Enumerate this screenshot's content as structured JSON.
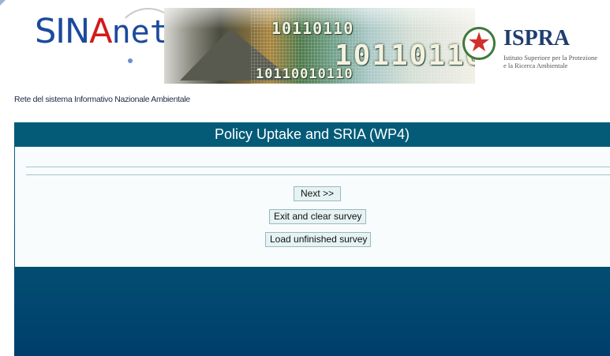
{
  "header": {
    "logo": {
      "part1": "SIN",
      "part2": "A",
      "part3": "net"
    },
    "banner_bits": [
      "10110110",
      "10110110",
      "10110010110"
    ],
    "ispra": {
      "title": "ISPRA",
      "subtitle_line1": "Istituto Superiore per la Protezione",
      "subtitle_line2": "e la Ricerca Ambientale"
    },
    "tagline": "Rete del sistema Informativo Nazionale Ambientale"
  },
  "survey": {
    "title": "Policy Uptake and SRIA (WP4)",
    "buttons": {
      "next": "Next >>",
      "exit": "Exit and clear survey",
      "load": "Load unfinished survey"
    }
  },
  "colors": {
    "panel_header": "#045b78",
    "panel_gradient_bottom": "#003e6c",
    "panel_body": "#f8fcfd",
    "button_background": "#e6f3f4",
    "logo_blue": "#1a4a9c",
    "logo_red": "#d21a1a"
  },
  "icons": {
    "emblem": "italian-republic-emblem-icon"
  }
}
